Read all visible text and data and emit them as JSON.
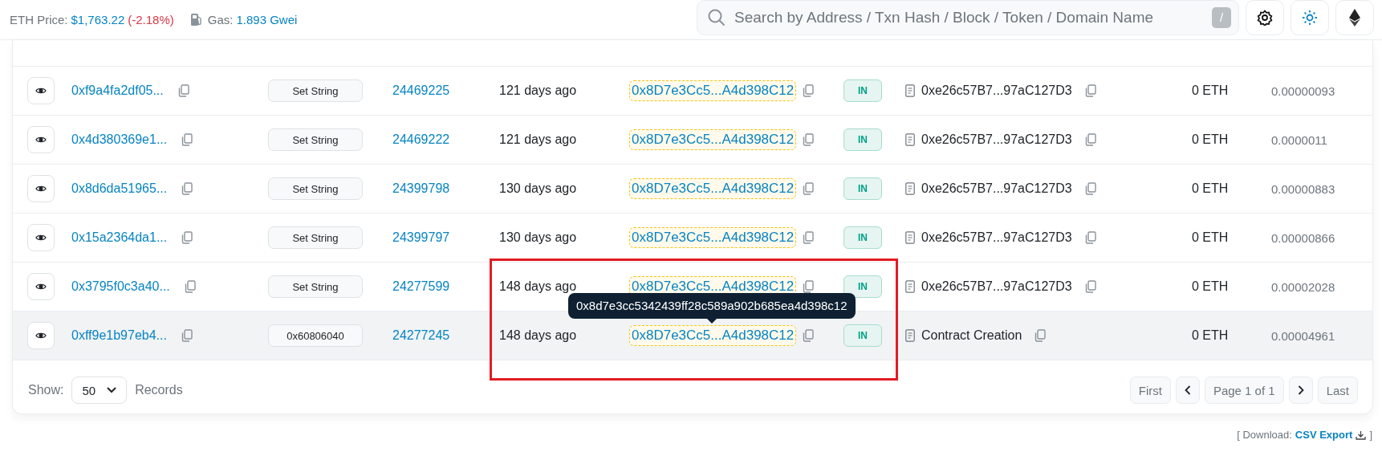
{
  "header": {
    "eth_price_label": "ETH Price:",
    "eth_price": "$1,763.22",
    "eth_change": "(-2.18%)",
    "gas_label": "Gas:",
    "gas": "1.893 Gwei",
    "search": {
      "placeholder": "Search by Address / Txn Hash / Block / Token / Domain Name",
      "shortcut": "/"
    }
  },
  "table": {
    "rows": [
      {
        "hash": "0xf9a4fa2df05...",
        "method": "Set String",
        "block": "24469225",
        "age": "121 days ago",
        "from": "0x8D7e3Cc5...A4d398C12",
        "direction": "IN",
        "to": "0xe26c57B7...97aC127D3",
        "value": "0 ETH",
        "fee": "0.00000093",
        "highlighted": false
      },
      {
        "hash": "0x4d380369e1...",
        "method": "Set String",
        "block": "24469222",
        "age": "121 days ago",
        "from": "0x8D7e3Cc5...A4d398C12",
        "direction": "IN",
        "to": "0xe26c57B7...97aC127D3",
        "value": "0 ETH",
        "fee": "0.0000011",
        "highlighted": false
      },
      {
        "hash": "0x8d6da51965...",
        "method": "Set String",
        "block": "24399798",
        "age": "130 days ago",
        "from": "0x8D7e3Cc5...A4d398C12",
        "direction": "IN",
        "to": "0xe26c57B7...97aC127D3",
        "value": "0 ETH",
        "fee": "0.00000883",
        "highlighted": false
      },
      {
        "hash": "0x15a2364da1...",
        "method": "Set String",
        "block": "24399797",
        "age": "130 days ago",
        "from": "0x8D7e3Cc5...A4d398C12",
        "direction": "IN",
        "to": "0xe26c57B7...97aC127D3",
        "value": "0 ETH",
        "fee": "0.00000866",
        "highlighted": false
      },
      {
        "hash": "0x3795f0c3a40...",
        "method": "Set String",
        "block": "24277599",
        "age": "148 days ago",
        "from": "0x8D7e3Cc5...A4d398C12",
        "direction": "IN",
        "to": "0xe26c57B7...97aC127D3",
        "value": "0 ETH",
        "fee": "0.00002028",
        "highlighted": false
      },
      {
        "hash": "0xff9e1b97eb4...",
        "method": "0x60806040",
        "block": "24277245",
        "age": "148 days ago",
        "from": "0x8D7e3Cc5...A4d398C12",
        "direction": "IN",
        "to": "Contract Creation",
        "value": "0 ETH",
        "fee": "0.00004961",
        "highlighted": true,
        "tooltip": "0x8d7e3cc5342439ff28c589a902b685ea4d398c12"
      }
    ],
    "footer": {
      "show_label": "Show:",
      "page_size": "50",
      "records_label": "Records",
      "pagination": {
        "first": "First",
        "page": "Page 1 of 1",
        "last": "Last"
      }
    }
  },
  "download": {
    "label": "[ Download:",
    "link": "CSV Export",
    "close": "]"
  }
}
